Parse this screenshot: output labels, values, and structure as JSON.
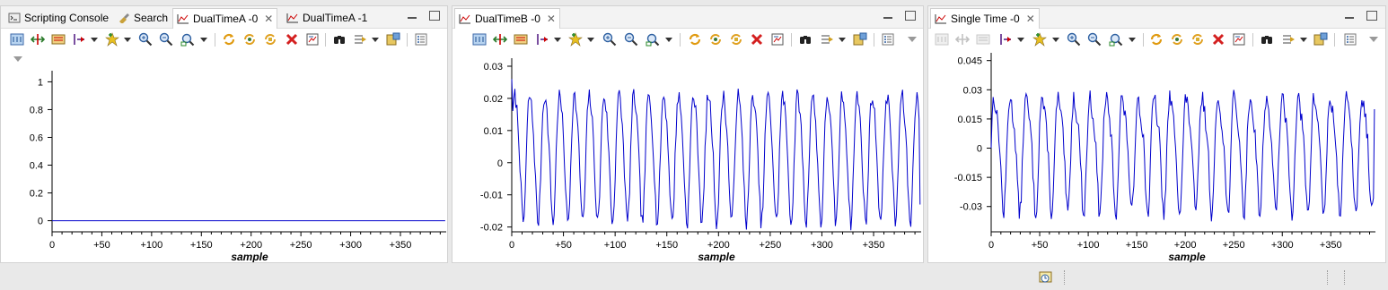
{
  "left_panel": {
    "tabs": [
      {
        "label": "Scripting Console",
        "icon": "console-icon"
      },
      {
        "label": "Search",
        "icon": "search-icon"
      },
      {
        "label": "DualTimeA -0",
        "icon": "chart-icon",
        "active": true
      },
      {
        "label": "DualTimeA -1",
        "icon": "chart-icon"
      }
    ]
  },
  "middle_panel": {
    "tab": {
      "label": "DualTimeB -0",
      "icon": "chart-icon"
    }
  },
  "right_panel": {
    "tab": {
      "label": "Single Time -0",
      "icon": "chart-icon"
    }
  },
  "chart_data": [
    {
      "type": "line",
      "title": "",
      "xlabel": "sample",
      "ylabel": "",
      "xlim": [
        0,
        396
      ],
      "ylim": [
        -0.08,
        1.08
      ],
      "xticks": [
        "0",
        "+50",
        "+100",
        "+150",
        "+200",
        "+250",
        "+300",
        "+350"
      ],
      "xtick_values": [
        0,
        50,
        100,
        150,
        200,
        250,
        300,
        350
      ],
      "yticks": [
        "1",
        "0.8",
        "0.6",
        "0.4",
        "0.2",
        "0"
      ],
      "ytick_values": [
        1,
        0.8,
        0.6,
        0.4,
        0.2,
        0
      ],
      "grid": false,
      "line_color": "#0000cc",
      "series": [
        {
          "kind": "constant",
          "value": 0,
          "n": 396
        }
      ]
    },
    {
      "type": "line",
      "title": "",
      "xlabel": "sample",
      "ylabel": "",
      "xlim": [
        0,
        396
      ],
      "ylim": [
        -0.0215,
        0.0325
      ],
      "xticks": [
        "0",
        "+50",
        "+100",
        "+150",
        "+200",
        "+250",
        "+300",
        "+350"
      ],
      "xtick_values": [
        0,
        50,
        100,
        150,
        200,
        250,
        300,
        350
      ],
      "yticks": [
        "0.03",
        "0.02",
        "0.01",
        "0",
        "-0.01",
        "-0.02"
      ],
      "ytick_values": [
        0.03,
        0.02,
        0.01,
        0,
        -0.01,
        -0.02
      ],
      "grid": false,
      "line_color": "#0000cc",
      "series": [
        {
          "kind": "oscillation",
          "n": 396,
          "period": 14.4,
          "offset": 0.003,
          "amplitude": 0.021,
          "harmonic2": 0.15,
          "noise": 0.0025,
          "start_value": 0.026,
          "end_value": -0.013,
          "seed": 7
        }
      ]
    },
    {
      "type": "line",
      "title": "",
      "xlabel": "sample",
      "ylabel": "",
      "xlim": [
        0,
        396
      ],
      "ylim": [
        -0.043,
        0.049
      ],
      "xticks": [
        "0",
        "+50",
        "+100",
        "+150",
        "+200",
        "+250",
        "+300",
        "+350"
      ],
      "xtick_values": [
        0,
        50,
        100,
        150,
        200,
        250,
        300,
        350
      ],
      "yticks": [
        "0.045",
        "0.03",
        "0.015",
        "0",
        "-0.015",
        "-0.03"
      ],
      "ytick_values": [
        0.045,
        0.03,
        0.015,
        0,
        -0.015,
        -0.03
      ],
      "grid": false,
      "line_color": "#0000cc",
      "series": [
        {
          "kind": "oscillation",
          "n": 396,
          "period": 16.5,
          "offset": 0.0,
          "amplitude": 0.032,
          "harmonic2": 0.25,
          "noise": 0.0045,
          "start_value": 0.0,
          "end_value": 0.02,
          "seed": 13
        }
      ]
    }
  ]
}
